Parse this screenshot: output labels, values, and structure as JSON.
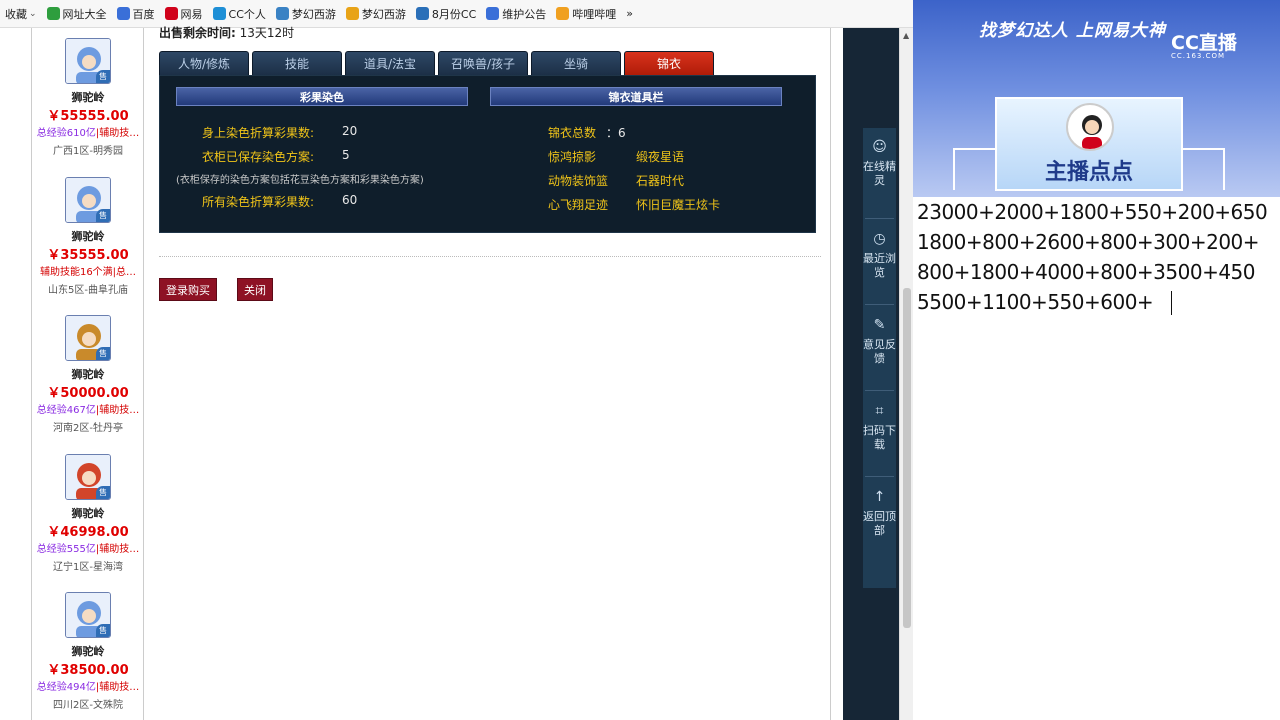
{
  "bookmarks": [
    {
      "label": "收藏",
      "color": "#ffffff",
      "arrow": "⌄"
    },
    {
      "label": "网址大全",
      "color": "#2e9e3e"
    },
    {
      "label": "百度",
      "color": "#3a6fd8"
    },
    {
      "label": "网易",
      "color": "#d0021b"
    },
    {
      "label": "CC个人",
      "color": "#1e8fd6"
    },
    {
      "label": "梦幻西游",
      "color": "#3a82c4"
    },
    {
      "label": "梦幻西游",
      "color": "#e8a317"
    },
    {
      "label": "8月份CC",
      "color": "#2a6fb8"
    },
    {
      "label": "维护公告",
      "color": "#3a6fd8"
    },
    {
      "label": "哔哩哔哩",
      "color": "#f0a020"
    }
  ],
  "bookmark_more": "»",
  "toolbar_colors": [
    "#2e9e3e",
    "#d0021b",
    "#3a6fd8",
    "#2e9e3e",
    "#2e9e3e",
    "#555555"
  ],
  "listing": [
    {
      "school": "狮驼岭",
      "price": "￥55555.00",
      "info_p": "总经验610亿",
      "info_r": "|辅助技…",
      "server": "广西1区-明秀园",
      "avatar": "#6d9be0"
    },
    {
      "school": "狮驼岭",
      "price": "￥35555.00",
      "info_p": "",
      "info_r": "辅助技能16个满|总…",
      "server": "山东5区-曲阜孔庙",
      "avatar": "#6d9be0"
    },
    {
      "school": "狮驼岭",
      "price": "￥50000.00",
      "info_p": "总经验467亿",
      "info_r": "|辅助技…",
      "server": "河南2区-牡丹亭",
      "avatar": "#c98a2b"
    },
    {
      "school": "狮驼岭",
      "price": "￥46998.00",
      "info_p": "总经验555亿",
      "info_r": "|辅助技…",
      "server": "辽宁1区-星海湾",
      "avatar": "#d2452a"
    },
    {
      "school": "狮驼岭",
      "price": "￥38500.00",
      "info_p": "总经验494亿",
      "info_r": "|辅助技…",
      "server": "四川2区-文殊院",
      "avatar": "#6d9be0"
    }
  ],
  "sell_badge": "售",
  "main": {
    "sale_time_label": "出售剩余时间:",
    "sale_time_value": "13天12时",
    "tabs": [
      "人物/修炼",
      "技能",
      "道具/法宝",
      "召唤兽/孩子",
      "坐骑",
      "锦衣"
    ],
    "active_tab": 5,
    "section_left": "彩果染色",
    "section_right": "锦衣道具栏",
    "dye_body_label": "身上染色折算彩果数:",
    "dye_body_value": "20",
    "wardrobe_label": "衣柜已保存染色方案:",
    "wardrobe_value": "5",
    "wardrobe_note": "(衣柜保存的染色方案包括花豆染色方案和彩果染色方案)",
    "all_dye_label": "所有染色折算彩果数:",
    "all_dye_value": "60",
    "jinyi_total_label": "锦衣总数",
    "jinyi_total_value": "：6",
    "jinyi_items": [
      "惊鸿掠影",
      "缎夜星语",
      "动物装饰篮",
      "石器时代",
      "心飞翔足迹",
      "怀旧巨魔王炫卡"
    ],
    "btn_buy": "登录购买",
    "btn_close": "关闭"
  },
  "sidebar": [
    {
      "icon": "☺",
      "label": "在线精灵"
    },
    {
      "icon": "◷",
      "label": "最近浏览"
    },
    {
      "icon": "✎",
      "label": "意见反馈"
    },
    {
      "icon": "⌗",
      "label": "扫码下载"
    },
    {
      "icon": "↑",
      "label": "返回顶部"
    }
  ],
  "stream": {
    "slogan": "找梦幻达人 上网易大神",
    "logo": "CC直播",
    "logo_sub": "CC.163.COM",
    "host": "主播点点"
  },
  "calc_lines": [
    "23000+2000+1800+550+200+650",
    "1800+800+2600+800+300+200+",
    "800+1800+4000+800+3500+450",
    "5500+1100+550+600+"
  ]
}
